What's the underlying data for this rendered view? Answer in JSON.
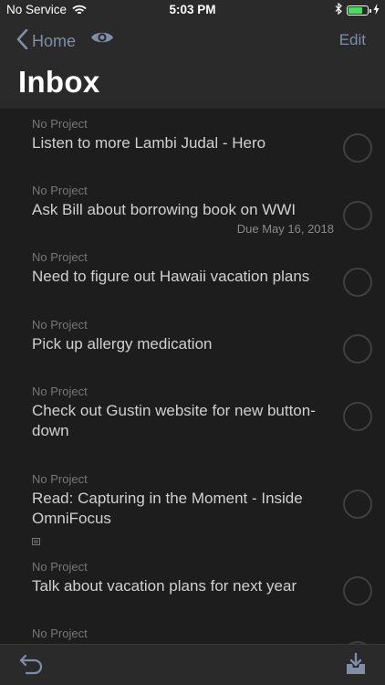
{
  "status_bar": {
    "carrier": "No Service",
    "time": "5:03 PM",
    "battery_level": 0.75,
    "colors": {
      "battery": "#4cd964"
    }
  },
  "nav": {
    "back_label": "Home",
    "edit_label": "Edit",
    "title": "Inbox"
  },
  "tasks": [
    {
      "project": "No Project",
      "title": "Listen to more Lambi Judal - Hero"
    },
    {
      "project": "No Project",
      "title": "Ask Bill about borrowing book on WWI",
      "due": "Due May 16, 2018"
    },
    {
      "project": "No Project",
      "title": "Need to figure out Hawaii vacation plans"
    },
    {
      "project": "No Project",
      "title": "Pick up allergy medication"
    },
    {
      "project": "No Project",
      "title": "Check out Gustin website for new button-down"
    },
    {
      "project": "No Project",
      "title": "Read: Capturing in the Moment - Inside OmniFocus",
      "has_note": true
    },
    {
      "project": "No Project",
      "title": "Talk about vacation plans for next year"
    },
    {
      "project": "No Project",
      "title": ""
    }
  ],
  "colors": {
    "accent": "#7f8ea8",
    "background": "#1d1d1e",
    "bar": "#2a2a2b"
  }
}
